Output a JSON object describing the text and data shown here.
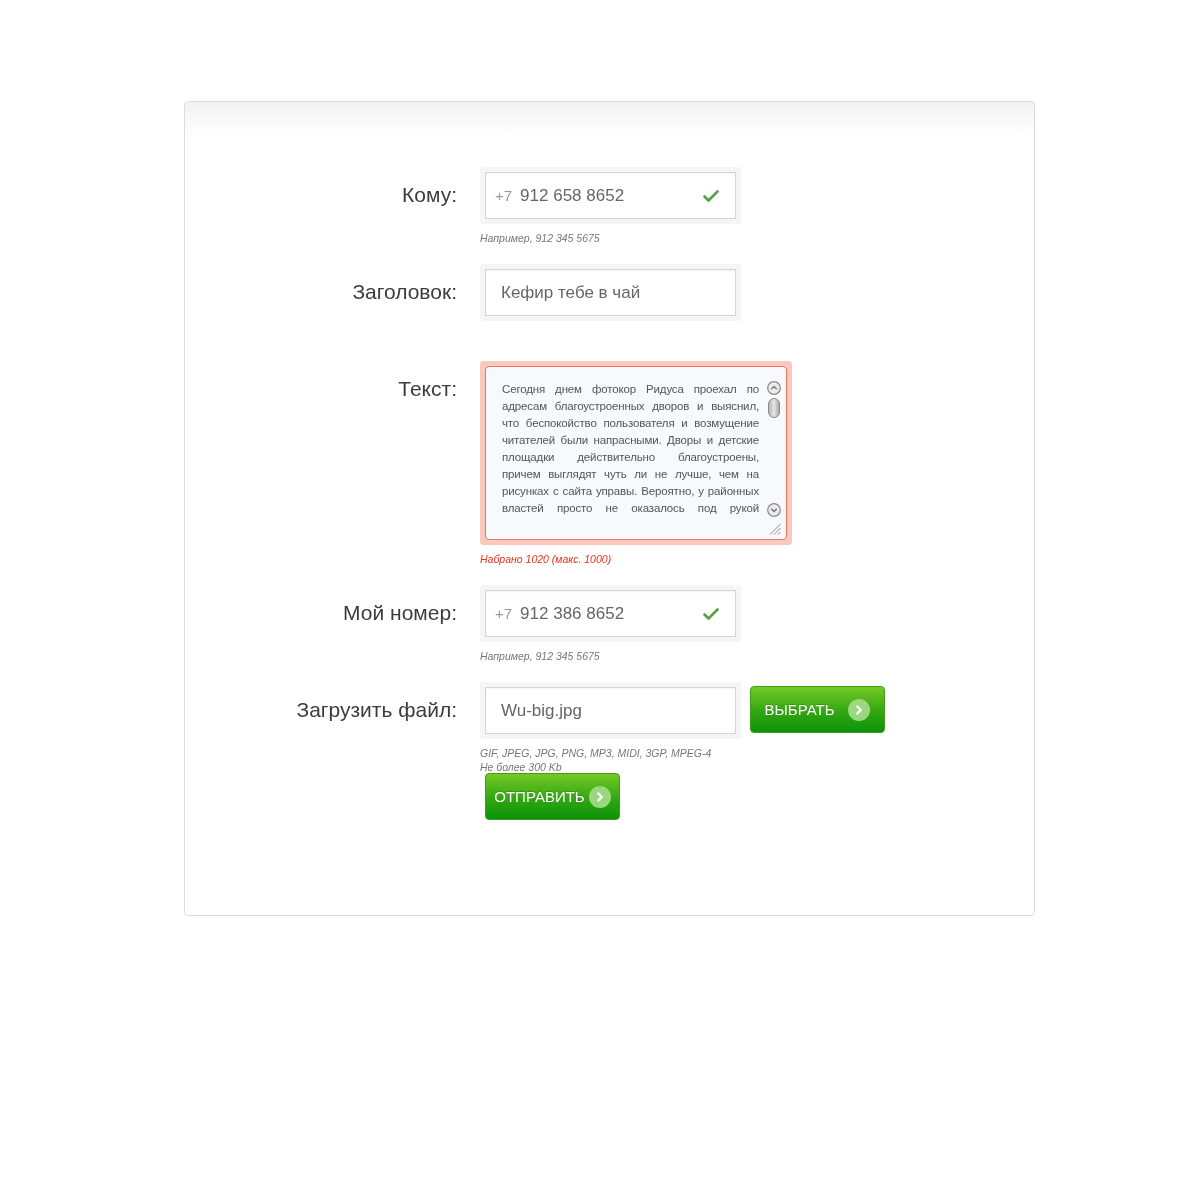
{
  "form": {
    "fields": [
      {
        "kind": "phone",
        "label": "Кому:",
        "prefix": "+7",
        "value": "912 658 8652",
        "valid": true,
        "error": false,
        "hints": [
          "Например, 912 345 5675"
        ]
      },
      {
        "kind": "text",
        "label": "Заголовок:",
        "value": "Кефир тебе в чай",
        "error": false
      },
      {
        "kind": "textarea",
        "label": "Текст:",
        "value": "Сегодня днем фотокор Ридуса проехал по адресам благоустроенных дворов и выяснил, что беспокойство пользователя и возмущение читателей были напрасными. Дворы и детские площадки действительно благоустроены, причем выглядят чуть ли не лучше, чем на рисунках с сайта управы. Вероятно, у районных властей просто не оказалось под рукой",
        "error": true,
        "hints": [
          "Набрано 1020 (макс. 1000)"
        ]
      },
      {
        "kind": "phone",
        "label": "Мой номер:",
        "prefix": "+7",
        "value": "912 386 8652",
        "valid": true,
        "error": false,
        "hints": [
          "Например, 912 345 5675"
        ]
      },
      {
        "kind": "file",
        "label": "Загрузить файл:",
        "value": "Wu-big.jpg",
        "button": "ВЫБРАТЬ",
        "error": false,
        "hints": [
          "GIF, JPEG, JPG, PNG, MP3, MIDI, 3GP, MPEG-4",
          "Не более 300 Kb"
        ]
      }
    ],
    "submit": "ОТПРАВИТЬ"
  }
}
